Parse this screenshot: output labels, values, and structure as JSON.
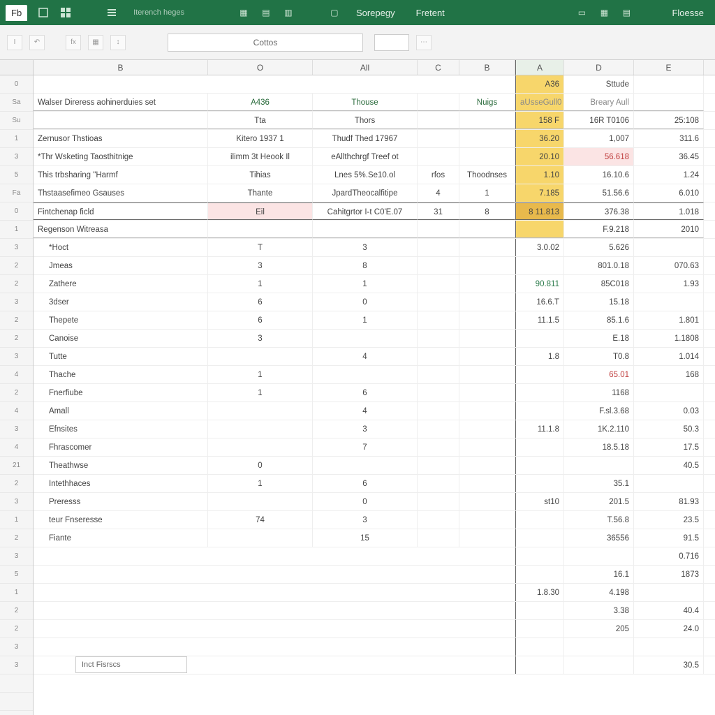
{
  "ribbon": {
    "file_tab": "Fb",
    "menu2": "Sorepegy",
    "menu3": "Fretent",
    "menu4": "Floesse",
    "tooltip": "Iterench heges"
  },
  "toolbar": {
    "formula_value": "Cottos"
  },
  "columns": {
    "main": [
      "B",
      "O",
      "All",
      "C",
      "B"
    ],
    "right": [
      "A",
      "D",
      "E"
    ]
  },
  "header_band": {
    "title": "Walser Direress aohinerduies set",
    "c1": "A436",
    "c2": "Thouse",
    "notes": "Nuigs",
    "rA_h": "A36",
    "rD_h": "Sttude",
    "rA_h2": "aUsseGull0",
    "rD_h2": "Breary Aull"
  },
  "subhead": {
    "a": "Tta",
    "b": "Thors",
    "rA": "158 F",
    "rD": "16R T0106",
    "rE": "25:108"
  },
  "block1": [
    {
      "label": "Zernusor Thstioas",
      "c1": "Kitero 1937 1",
      "c2": "Thudf Thed 17967",
      "rA": "36.20",
      "rD": "1,007",
      "rE": "311.6"
    },
    {
      "label": "*Thr Wsketing  Taosthitnige",
      "c1": "ilimm 3t Heook Il",
      "c2": "eAllthchrgf Treef ot",
      "rA": "20.10",
      "rD": "56.618",
      "rE": "36.45",
      "rD_pink": true
    },
    {
      "label": "This trbsharing \"Harmf",
      "c1": "Tihias",
      "c2": "Lnes 5%.Se10.ol",
      "c3": "rfos",
      "c4": "Thoodnses",
      "rA": "1.10",
      "rD": "16.10.6",
      "rE": "1.24"
    },
    {
      "label": "Thstaasefimeo Gsauses",
      "c1": "Thante",
      "c2": "JpardTheocalfitipe",
      "c3": "4",
      "c4": "1",
      "rA": "7.185",
      "rD": "51.56.6",
      "rE": "6.010"
    },
    {
      "label": "Fintchenap ficld",
      "c0": "Eil",
      "c2": "Cahitgrtor I-t C0'E.07",
      "c4s": "31",
      "c4": "8",
      "rA": "8 11.813",
      "rD": "376.38",
      "rE": "1.018",
      "eil_pink": true,
      "boxed": true,
      "rA_hi2": true
    },
    {
      "label": "Regenson Witreasa",
      "section": true,
      "rD": "F.9.218",
      "rE": "2010"
    }
  ],
  "list": [
    {
      "label": "*Hoct",
      "v1": "T",
      "v2": "3",
      "rA": "3.0.02",
      "rD": "5.626",
      "rE": ""
    },
    {
      "label": "Jmeas",
      "v1": "3",
      "v2": "8",
      "rA": "",
      "rD": "801.0.18",
      "rE": "070.63"
    },
    {
      "label": "Zathere",
      "v1": "1",
      "v2": "1",
      "rA": "90.811",
      "rD": "85C018",
      "rE": "1.93",
      "rA_green": true
    },
    {
      "label": "3dser",
      "v1": "6",
      "v2": "0",
      "rA": "16.6.T",
      "rD": "15.18",
      "rE": ""
    },
    {
      "label": "Thepete",
      "v1": "6",
      "v2": "1",
      "rA": "11.1.5",
      "rD": "85.1.6",
      "rE": "1.801"
    },
    {
      "label": "Canoise",
      "v1": "3",
      "v2": "",
      "rA": "",
      "rD": "E.18",
      "rE": "1.1808"
    },
    {
      "label": "Tutte",
      "v1": "",
      "v2": "4",
      "rA": "1.8",
      "rD": "T0.8",
      "rE": "1.014"
    },
    {
      "label": "Thache",
      "v1": "1",
      "v2": "",
      "rA": "",
      "rD": "65.01",
      "rE": "168",
      "rD_red": true
    },
    {
      "label": "Fnerfiube",
      "v1": "1",
      "v2": "6",
      "rA": "",
      "rD": "1168",
      "rE": ""
    },
    {
      "label": "Amall",
      "v1": "",
      "v2": "4",
      "rA": "",
      "rD": "F.sl.3.68",
      "rE": "0.03"
    },
    {
      "label": "Efnsites",
      "v1": "",
      "v2": "3",
      "rA": "11.1.8",
      "rD": "1K.2.110",
      "rE": "50.3"
    },
    {
      "label": "Fhrascomer",
      "v1": "",
      "v2": "7",
      "rA": "",
      "rD": "18.5.18",
      "rE": "17.5"
    },
    {
      "label": "Theathwse",
      "v1": "0",
      "v2": "",
      "rA": "",
      "rD": "",
      "rE": "40.5"
    },
    {
      "label": "Intethhaces",
      "v1": "1",
      "v2": "6",
      "rA": "",
      "rD": "35.1",
      "rE": ""
    },
    {
      "label": "Preresss",
      "v1": "",
      "v2": "0",
      "rA": "st10",
      "rD": "201.5",
      "rE": "81.93"
    },
    {
      "label": "teur Fnseresse",
      "v1": "74",
      "v2": "3",
      "rA": "",
      "rD": "T.56.8",
      "rE": "23.5"
    },
    {
      "label": "Fiante",
      "v1": "",
      "v2": "15",
      "rA": "",
      "rD": "36556",
      "rE": "91.5"
    }
  ],
  "tail_right": [
    {
      "rA": "",
      "rD": "",
      "rE": "0.716"
    },
    {
      "rA": "",
      "rD": "16.1",
      "rE": "1873"
    },
    {
      "rA": "1.8.30",
      "rD": "4.198",
      "rE": ""
    },
    {
      "rA": "",
      "rD": "3.38",
      "rE": "40.4"
    },
    {
      "rA": "",
      "rD": "205",
      "rE": "24.0"
    },
    {
      "rA": "",
      "rD": "",
      "rE": ""
    },
    {
      "rA": "",
      "rD": "",
      "rE": "30.5"
    }
  ],
  "bottom_input": "Inct Fisrscs"
}
